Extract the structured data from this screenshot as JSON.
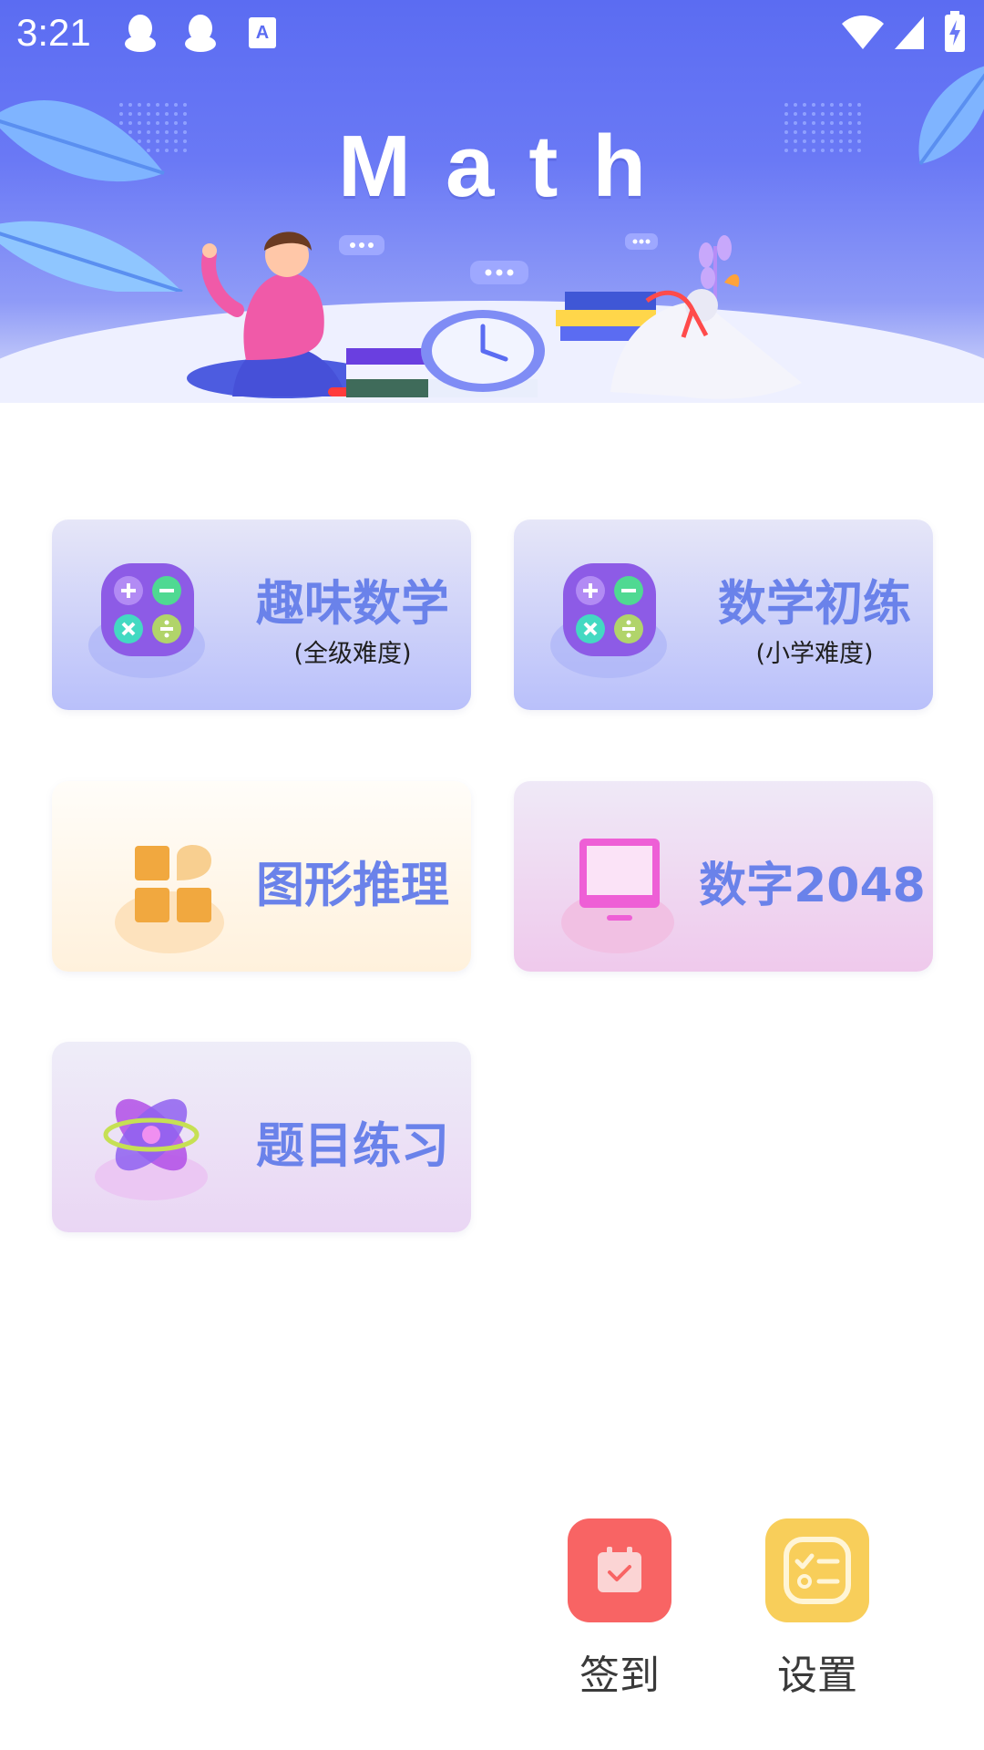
{
  "status_bar": {
    "time": "3:21",
    "left_icons": [
      "qq-icon",
      "qq-icon",
      "text-a-icon"
    ],
    "right_icons": [
      "wifi-icon",
      "signal-icon",
      "battery-charging-icon"
    ]
  },
  "banner": {
    "title": "Math",
    "colors": {
      "gradient_top": "#5b6cf2",
      "gradient_bottom": "#dfe3fb"
    }
  },
  "cards": [
    {
      "title": "趣味数学",
      "subtitle": "(全级难度)",
      "icon": "calculator-icon",
      "theme": "blue"
    },
    {
      "title": "数学初练",
      "subtitle": "(小学难度)",
      "icon": "calculator-icon",
      "theme": "blue"
    },
    {
      "title": "图形推理",
      "icon": "shapes-grid-icon",
      "theme": "orange"
    },
    {
      "title": "数字2048",
      "icon": "monitor-icon",
      "theme": "pink"
    },
    {
      "title": "题目练习",
      "icon": "atom-icon",
      "theme": "purple"
    }
  ],
  "bottom_actions": [
    {
      "label": "签到",
      "icon": "calendar-check-icon",
      "color": "#f86464"
    },
    {
      "label": "设置",
      "icon": "checklist-settings-icon",
      "color": "#f8ce5a"
    }
  ],
  "colors": {
    "card_title": "#6a82ea",
    "card_blue": "#b9c0fa",
    "card_orange": "#fff1dc",
    "card_pink": "#efc9ec",
    "card_purple": "#ead6f4"
  }
}
